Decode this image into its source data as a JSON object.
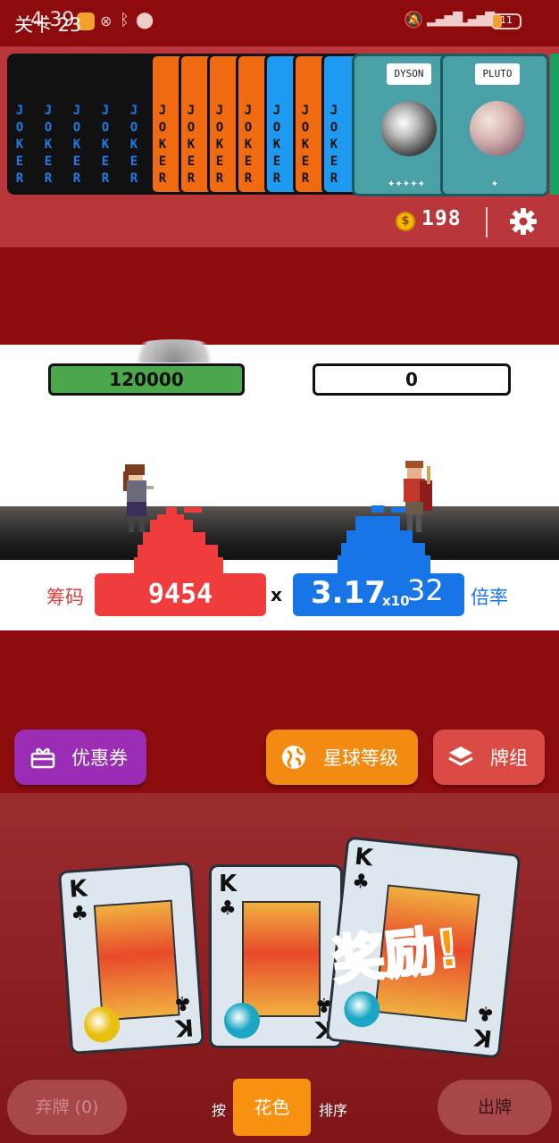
{
  "status_bar": {
    "time": "4:39",
    "battery": "11"
  },
  "jokers": [
    {
      "text": "JOKER",
      "bg": "#111111",
      "color": "#1e7be8"
    },
    {
      "text": "JOKER",
      "bg": "#111111",
      "color": "#1e7be8"
    },
    {
      "text": "JOKER",
      "bg": "#111111",
      "color": "#1e7be8"
    },
    {
      "text": "JOKER",
      "bg": "#111111",
      "color": "#1e7be8"
    },
    {
      "text": "JOKER",
      "bg": "#111111",
      "color": "#1e7be8"
    },
    {
      "text": "JOKER",
      "bg": "#f06a10",
      "color": "#111111"
    },
    {
      "text": "JOKER",
      "bg": "#f06a10",
      "color": "#111111"
    },
    {
      "text": "JOKER",
      "bg": "#f06a10",
      "color": "#111111"
    },
    {
      "text": "JOKER",
      "bg": "#f06a10",
      "color": "#111111"
    },
    {
      "text": "JOKER",
      "bg": "#1e9bf0",
      "color": "#111111"
    },
    {
      "text": "JOKER",
      "bg": "#f06a10",
      "color": "#111111"
    },
    {
      "text": "JOKER",
      "bg": "#1e9bf0",
      "color": "#111111"
    }
  ],
  "planets": [
    {
      "name": "DYSON",
      "stars": "✦✦✦✦✦"
    },
    {
      "name": "PLUTO",
      "stars": "✦"
    }
  ],
  "header": {
    "level": "关卡 23",
    "coins": "198"
  },
  "battle": {
    "player_hp": "120000",
    "enemy_hp": "0",
    "chips_label": "筹码",
    "chips_value": "9454",
    "times": "x",
    "mult_mantissa": "3.17",
    "mult_base": "x10",
    "mult_exponent": "32",
    "mult_label": "倍率"
  },
  "actions": {
    "coupon": "优惠券",
    "planet_level": "星球等级",
    "deck": "牌组"
  },
  "hand": [
    {
      "rank": "K",
      "suit": "♣",
      "seal": "#e8c010"
    },
    {
      "rank": "K",
      "suit": "♣",
      "seal": "#1aa6c4"
    },
    {
      "rank": "K",
      "suit": "♣",
      "seal": "#1aa6c4"
    }
  ],
  "reward_text": "奖励!",
  "controls": {
    "discard": "弃牌 (0)",
    "sort_prefix": "按",
    "sort_suit": "花色",
    "sort_suffix": "排序",
    "play": "出牌"
  },
  "colors": {
    "chips": "#f03c3c",
    "mult": "#1775e8",
    "accent": "#f7910f"
  }
}
